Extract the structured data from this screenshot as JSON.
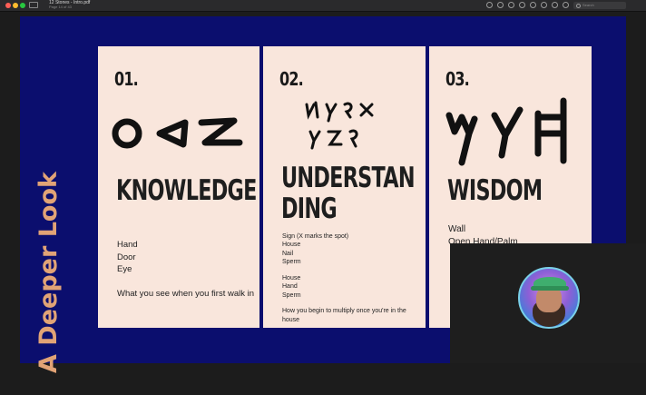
{
  "window": {
    "title": "12 Stones - Intro.pdf",
    "subtitle": "Page 14 of 43",
    "search_placeholder": "Search"
  },
  "toolbar": {
    "icons": [
      "info-icon",
      "zoom-out-icon",
      "zoom-in-icon",
      "share-icon",
      "highlight-icon",
      "rotate-icon",
      "markup-icon",
      "form-icon"
    ]
  },
  "slide": {
    "vertical_title": "A Deeper Look",
    "cards": [
      {
        "number": "01.",
        "heading": "KNOWLEDGE",
        "items": [
          "Hand",
          "Door",
          "Eye"
        ],
        "description": "What you see when you first walk in"
      },
      {
        "number": "02.",
        "heading_line1": "UNDERSTAN",
        "heading_line2": "DING",
        "items1": [
          "Sign (X marks the spot)",
          "House",
          "Nail",
          "Sperm"
        ],
        "items2": [
          "House",
          "Hand",
          "Sperm"
        ],
        "description": "How you begin to multiply once you're in the house"
      },
      {
        "number": "03.",
        "heading": "WISDOM",
        "items": [
          "Wall",
          "Open Hand/Palm"
        ]
      }
    ]
  },
  "colors": {
    "slide_bg": "#0b0e6e",
    "card_bg": "#f9e6dc",
    "accent": "#e1a376"
  }
}
